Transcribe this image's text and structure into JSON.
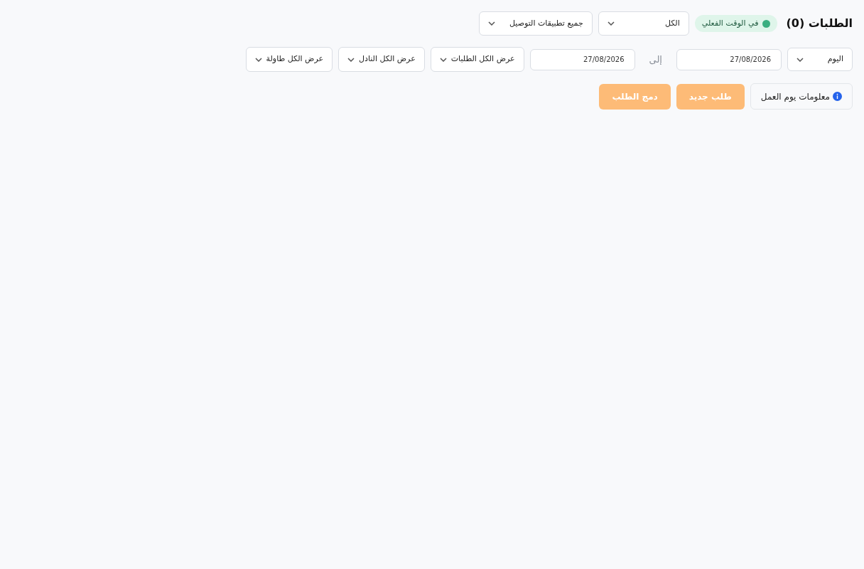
{
  "header": {
    "title": "الطلبات (0)",
    "live_badge": {
      "label": "في الوقت الفعلي",
      "on": true
    },
    "selects": [
      {
        "value": "الكل"
      },
      {
        "value": "جميع تطبيقات التوصيل"
      }
    ]
  },
  "filters": {
    "period": {
      "value": "اليوم"
    },
    "date_from": {
      "value": "27/08/2026"
    },
    "separator": "إلى",
    "date_to": {
      "value": "27/08/2026"
    },
    "selects": [
      {
        "value": "عرض الكل الطلبات"
      },
      {
        "value": "عرض الكل النادل"
      },
      {
        "value": "عرض الكل طاولة"
      }
    ]
  },
  "actions": [
    {
      "kind": "info",
      "label": "معلومات يوم العمل"
    },
    {
      "kind": "primary",
      "label": "طلب جديد"
    },
    {
      "kind": "primary",
      "label": "دمج الطلب"
    }
  ]
}
